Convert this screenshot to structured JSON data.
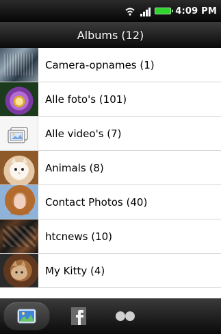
{
  "status": {
    "time": "4:09 PM",
    "icons": [
      "wifi-icon",
      "signal-icon",
      "battery-icon"
    ],
    "battery_color": "#2fd42f"
  },
  "header": {
    "title": "Albums (12)"
  },
  "albums": [
    {
      "label": "Camera-opnames (1)",
      "icon": "camera-album-thumbnail"
    },
    {
      "label": "Alle foto's (101)",
      "icon": "flower-thumbnail"
    },
    {
      "label": "Alle video's (7)",
      "icon": "video-album-icon"
    },
    {
      "label": "Animals (8)",
      "icon": "animals-thumbnail"
    },
    {
      "label": "Contact Photos (40)",
      "icon": "contact-photo-thumbnail"
    },
    {
      "label": "htcnews (10)",
      "icon": "htcnews-thumbnail"
    },
    {
      "label": "My Kitty (4)",
      "icon": "kitty-thumbnail"
    }
  ],
  "bottom_tabs": [
    {
      "name": "gallery-tab",
      "icon": "gallery-icon"
    },
    {
      "name": "facebook-tab",
      "icon": "facebook-icon"
    },
    {
      "name": "flickr-tab",
      "icon": "flickr-icon"
    }
  ]
}
